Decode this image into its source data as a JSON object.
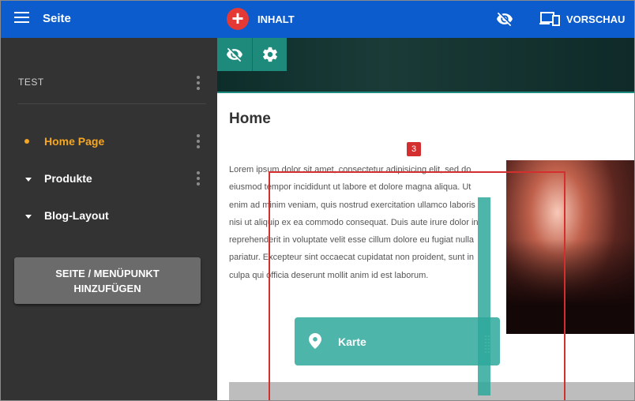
{
  "topbar": {
    "title": "Seite",
    "add_label": "INHALT",
    "preview_label": "VORSCHAU",
    "add_icon_glyph": "+",
    "accent": "#0c5ccd"
  },
  "sidebar": {
    "site_label": "TEST",
    "items": [
      {
        "label": "Home Page",
        "active": true
      },
      {
        "label": "Produkte"
      },
      {
        "label": "Blog-Layout"
      }
    ],
    "add_button_line1": "SEITE / MENÜPUNKT",
    "add_button_line2": "HINZUFÜGEN"
  },
  "content": {
    "page_title": "Home",
    "badge": "3",
    "lorem": "Lorem ipsum dolor sit amet, consectetur adipisicing elit, sed do eiusmod tempor incididunt ut labore et dolore magna aliqua. Ut enim ad minim veniam, quis nostrud exercitation ullamco laboris nisi ut aliquip ex ea commodo consequat. Duis aute irure dolor in reprehenderit in voluptate velit esse cillum dolore eu fugiat nulla pariatur. Excepteur sint occaecat cupidatat non proident, sunt in culpa qui officia deserunt mollit anim id est laborum.",
    "map_label": "Karte"
  },
  "icons": [
    "menu-icon",
    "plus-icon",
    "eye-off-icon",
    "devices-icon",
    "gear-icon",
    "location-pin-icon",
    "more-vert-icon",
    "caret-down-icon",
    "drag-handle-icon"
  ]
}
